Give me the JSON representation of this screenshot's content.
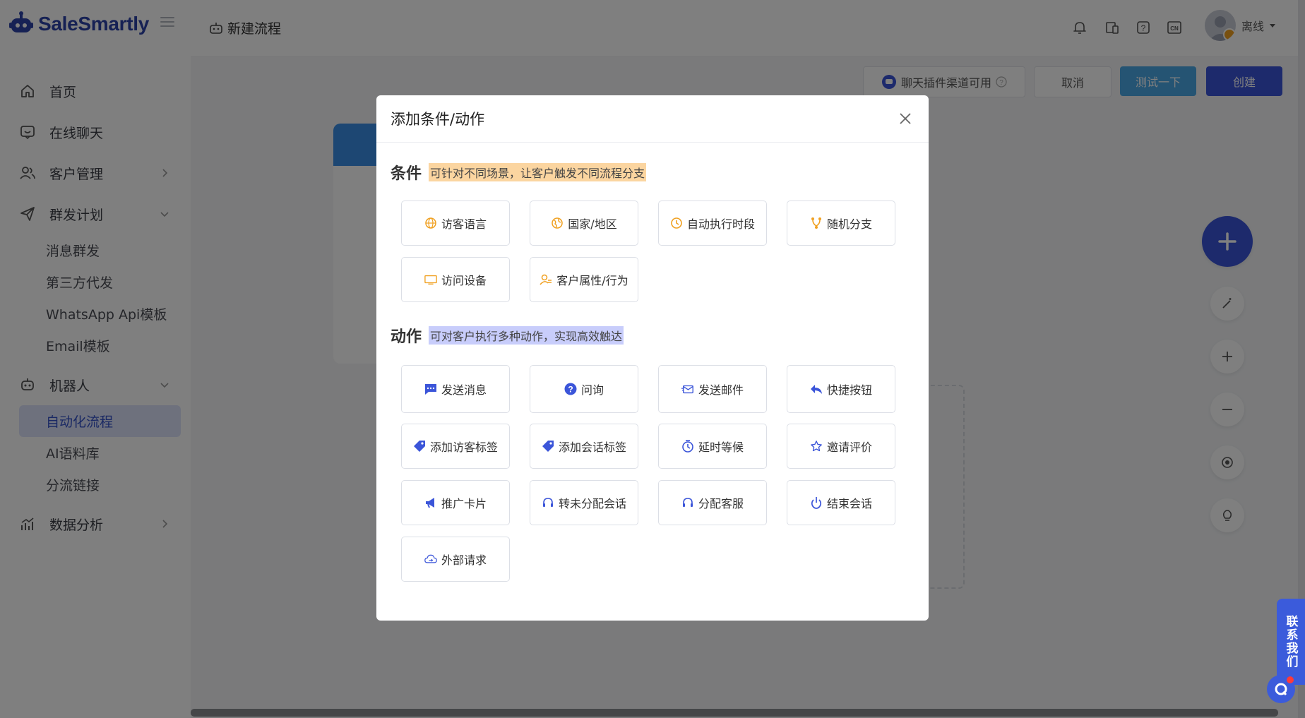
{
  "app": {
    "logo_text": "SaleSmartly"
  },
  "sidebar": {
    "items": [
      {
        "label": "首页",
        "icon": "home-icon"
      },
      {
        "label": "在线聊天",
        "icon": "chat-icon"
      },
      {
        "label": "客户管理",
        "icon": "users-icon"
      },
      {
        "label": "群发计划",
        "icon": "send-icon"
      },
      {
        "label": "机器人",
        "icon": "robot-icon"
      },
      {
        "label": "数据分析",
        "icon": "chart-icon"
      }
    ],
    "broadcast_sub": [
      "消息群发",
      "第三方代发",
      "WhatsApp Api模板",
      "Email模板"
    ],
    "robot_sub": [
      "自动化流程",
      "AI语料库",
      "分流链接"
    ]
  },
  "header": {
    "breadcrumb": "新建流程",
    "user_status": "离线"
  },
  "toolbar": {
    "channel_label": "聊天插件渠道可用",
    "cancel_label": "取消",
    "test_label": "测试一下",
    "create_label": "创建"
  },
  "contact_tab": "联系我们",
  "modal": {
    "title": "添加条件/动作",
    "conditions": {
      "title": "条件",
      "hint": "可针对不同场景，让客户触发不同流程分支",
      "items": [
        {
          "label": "访客语言",
          "icon": "globe-icon"
        },
        {
          "label": "国家/地区",
          "icon": "earth-icon"
        },
        {
          "label": "自动执行时段",
          "icon": "clock-icon"
        },
        {
          "label": "随机分支",
          "icon": "branch-icon"
        },
        {
          "label": "访问设备",
          "icon": "monitor-icon"
        },
        {
          "label": "客户属性/行为",
          "icon": "user-attr-icon"
        }
      ]
    },
    "actions": {
      "title": "动作",
      "hint": "可对客户执行多种动作，实现高效触达",
      "items": [
        {
          "label": "发送消息",
          "icon": "message-icon"
        },
        {
          "label": "问询",
          "icon": "question-icon"
        },
        {
          "label": "发送邮件",
          "icon": "mail-icon"
        },
        {
          "label": "快捷按钮",
          "icon": "reply-icon"
        },
        {
          "label": "添加访客标签",
          "icon": "tag-icon"
        },
        {
          "label": "添加会话标签",
          "icon": "tag-icon"
        },
        {
          "label": "延时等候",
          "icon": "timer-icon"
        },
        {
          "label": "邀请评价",
          "icon": "star-icon"
        },
        {
          "label": "推广卡片",
          "icon": "megaphone-icon"
        },
        {
          "label": "转未分配会话",
          "icon": "headset-icon"
        },
        {
          "label": "分配客服",
          "icon": "headset-icon"
        },
        {
          "label": "结束会话",
          "icon": "power-icon"
        },
        {
          "label": "外部请求",
          "icon": "cloud-icon"
        }
      ]
    }
  },
  "colors": {
    "brand": "#2d43a8",
    "condition_icon": "#f0a020",
    "action_icon": "#3b55d9",
    "primary_button": "#3b55d9",
    "test_button": "#4aa8e6"
  }
}
